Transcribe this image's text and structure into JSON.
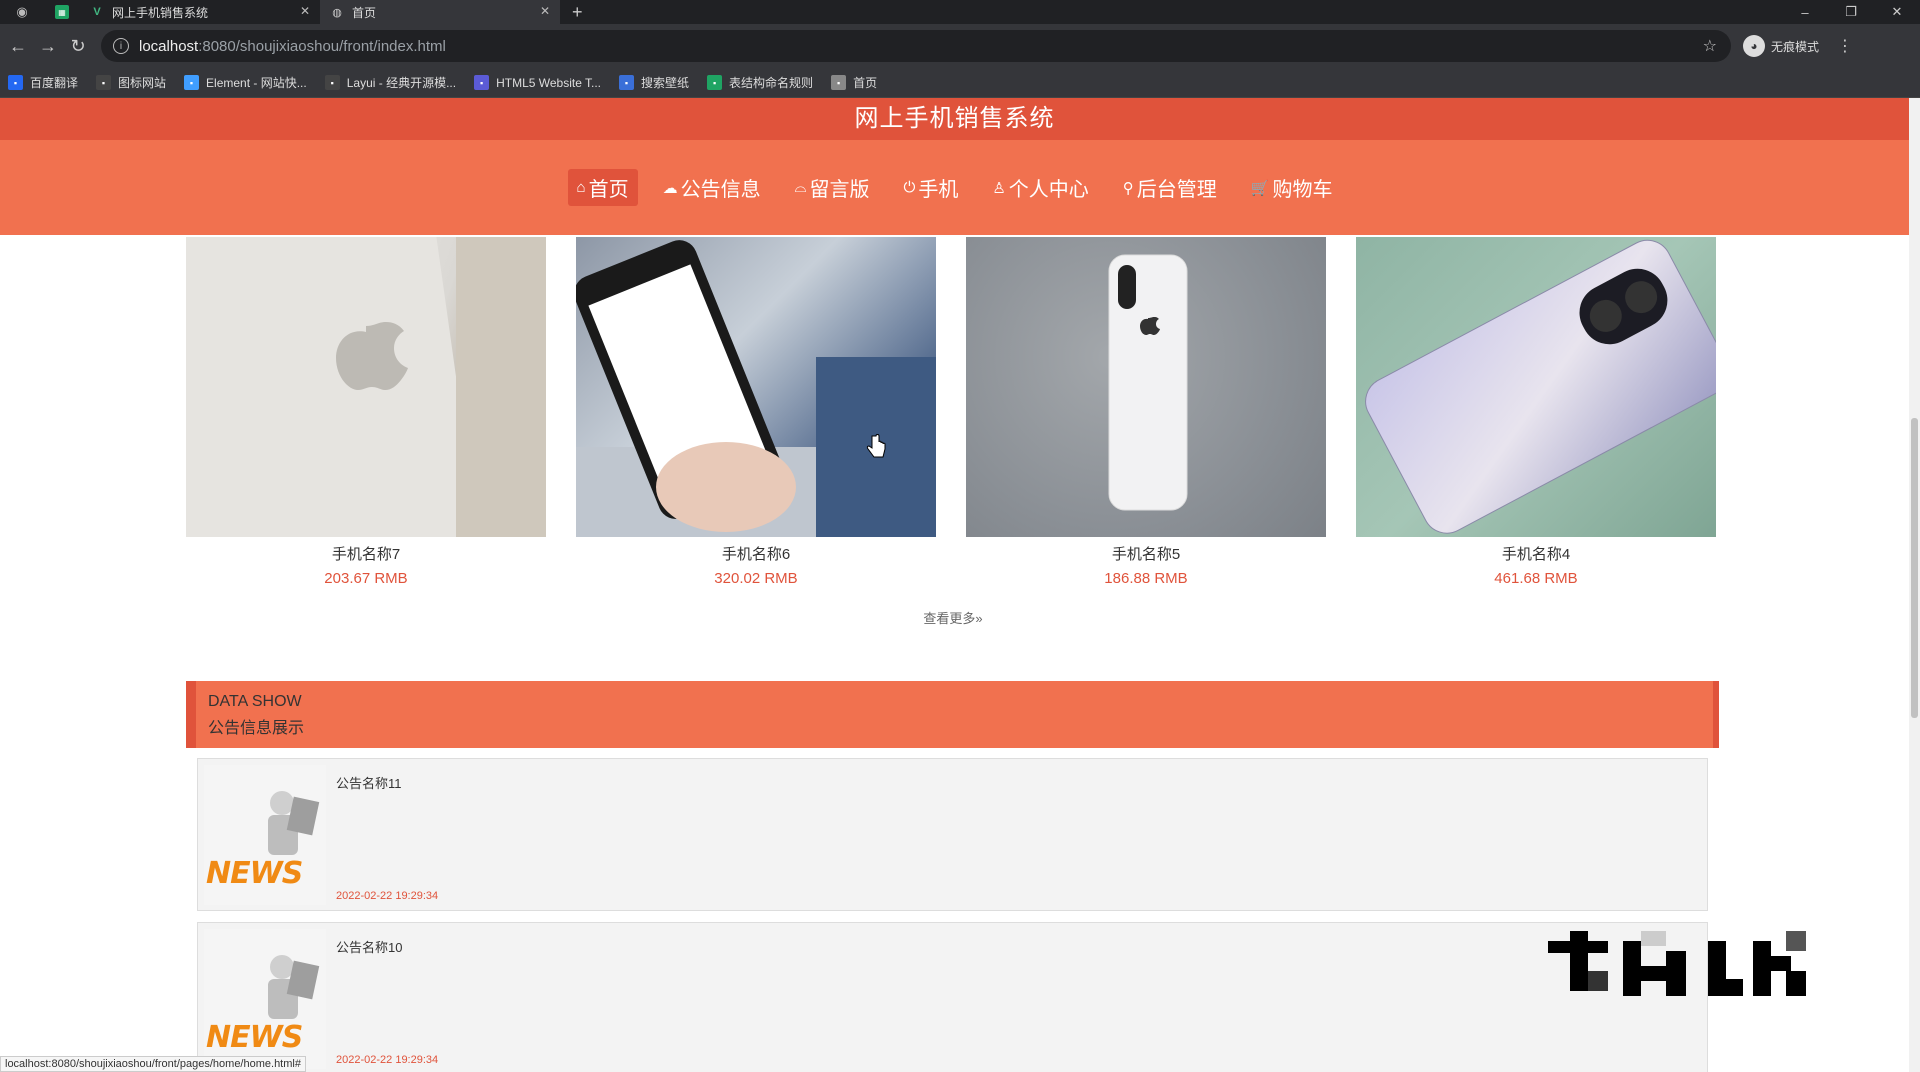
{
  "browser": {
    "tabs": [
      {
        "title": "网上手机销售系统",
        "active": false
      },
      {
        "title": "首页",
        "active": true
      }
    ],
    "address": {
      "host": "localhost",
      "path": ":8080/shoujixiaoshou/front/index.html"
    },
    "profile_label": "无痕模式",
    "bookmarks": [
      {
        "label": "百度翻译",
        "icon": "translate-icon",
        "color": "#2468f2"
      },
      {
        "label": "图标网站",
        "icon": "flag-icon",
        "color": "#444444"
      },
      {
        "label": "Element - 网站快...",
        "icon": "element-icon",
        "color": "#409eff"
      },
      {
        "label": "Layui - 经典开源模...",
        "icon": "layui-icon",
        "color": "#444444"
      },
      {
        "label": "HTML5 Website T...",
        "icon": "html5-icon",
        "color": "#5b5bd6"
      },
      {
        "label": "搜索壁纸",
        "icon": "wallpaper-icon",
        "color": "#3a6fd8"
      },
      {
        "label": "表结构命名规则",
        "icon": "sheet-icon",
        "color": "#1fa463"
      },
      {
        "label": "首页",
        "icon": "globe-icon",
        "color": "#888888"
      }
    ],
    "status_url": "localhost:8080/shoujixiaoshou/front/pages/home/home.html#"
  },
  "site": {
    "title": "网上手机销售系统",
    "nav": [
      {
        "label": "首页",
        "icon": "⌂",
        "active": true
      },
      {
        "label": "公告信息",
        "icon": "☁",
        "active": false
      },
      {
        "label": "留言版",
        "icon": "⌓",
        "active": false
      },
      {
        "label": "手机",
        "icon": "⏻",
        "active": false
      },
      {
        "label": "个人中心",
        "icon": "♙",
        "active": false
      },
      {
        "label": "后台管理",
        "icon": "⚲",
        "active": false
      },
      {
        "label": "购物车",
        "icon": "🛒",
        "active": false
      }
    ]
  },
  "products": [
    {
      "name": "手机名称7",
      "price": "203.67 RMB"
    },
    {
      "name": "手机名称6",
      "price": "320.02 RMB"
    },
    {
      "name": "手机名称5",
      "price": "186.88 RMB"
    },
    {
      "name": "手机名称4",
      "price": "461.68 RMB"
    }
  ],
  "more_label": "查看更多»",
  "notice_section": {
    "en_title": "DATA SHOW",
    "zh_title": "公告信息展示",
    "items": [
      {
        "title": "公告名称11",
        "date": "2022-02-22 19:29:34"
      },
      {
        "title": "公告名称10",
        "date": "2022-02-22 19:29:34"
      }
    ],
    "thumb_text": "NEWS"
  },
  "colors": {
    "primary": "#e0533b",
    "nav_bg": "#f1714f",
    "accent_text": "#e0533b"
  }
}
